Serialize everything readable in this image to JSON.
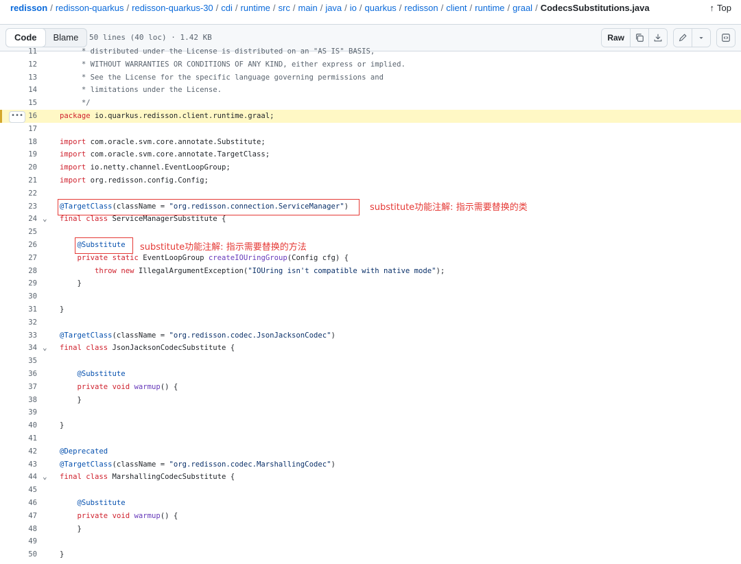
{
  "breadcrumb": {
    "root": "redisson",
    "parts": [
      "redisson-quarkus",
      "redisson-quarkus-30",
      "cdi",
      "runtime",
      "src",
      "main",
      "java",
      "io",
      "quarkus",
      "redisson",
      "client",
      "runtime",
      "graal"
    ],
    "separator": "/",
    "file": "CodecsSubstitutions.java"
  },
  "top_link": "Top",
  "file_header": {
    "tabs": [
      "Code",
      "Blame"
    ],
    "meta": "50 lines (40 loc) · 1.42 KB",
    "raw_label": "Raw"
  },
  "code_lines": [
    {
      "n": "11",
      "t": "     * distributed under the License is distributed on an \"AS IS\" BASIS,"
    },
    {
      "n": "12",
      "t": "     * WITHOUT WARRANTIES OR CONDITIONS OF ANY KIND, either express or implied."
    },
    {
      "n": "13",
      "t": "     * See the License for the specific language governing permissions and"
    },
    {
      "n": "14",
      "t": "     * limitations under the License."
    },
    {
      "n": "15",
      "t": "     */"
    },
    {
      "n": "16",
      "t": "package io.quarkus.redisson.client.runtime.graal;"
    },
    {
      "n": "17",
      "t": ""
    },
    {
      "n": "18",
      "t": "import com.oracle.svm.core.annotate.Substitute;"
    },
    {
      "n": "19",
      "t": "import com.oracle.svm.core.annotate.TargetClass;"
    },
    {
      "n": "20",
      "t": "import io.netty.channel.EventLoopGroup;"
    },
    {
      "n": "21",
      "t": "import org.redisson.config.Config;"
    },
    {
      "n": "22",
      "t": ""
    },
    {
      "n": "23",
      "t": "@TargetClass(className = \"org.redisson.connection.ServiceManager\")"
    },
    {
      "n": "24",
      "t": "final class ServiceManagerSubstitute {"
    },
    {
      "n": "25",
      "t": ""
    },
    {
      "n": "26",
      "t": "    @Substitute"
    },
    {
      "n": "27",
      "t": "    private static EventLoopGroup createIOUringGroup(Config cfg) {"
    },
    {
      "n": "28",
      "t": "        throw new IllegalArgumentException(\"IOUring isn't compatible with native mode\");"
    },
    {
      "n": "29",
      "t": "    }"
    },
    {
      "n": "30",
      "t": ""
    },
    {
      "n": "31",
      "t": "}"
    },
    {
      "n": "32",
      "t": ""
    },
    {
      "n": "33",
      "t": "@TargetClass(className = \"org.redisson.codec.JsonJacksonCodec\")"
    },
    {
      "n": "34",
      "t": "final class JsonJacksonCodecSubstitute {"
    },
    {
      "n": "35",
      "t": ""
    },
    {
      "n": "36",
      "t": "    @Substitute"
    },
    {
      "n": "37",
      "t": "    private void warmup() {"
    },
    {
      "n": "38",
      "t": "    }"
    },
    {
      "n": "39",
      "t": ""
    },
    {
      "n": "40",
      "t": "}"
    },
    {
      "n": "41",
      "t": ""
    },
    {
      "n": "42",
      "t": "@Deprecated"
    },
    {
      "n": "43",
      "t": "@TargetClass(className = \"org.redisson.codec.MarshallingCodec\")"
    },
    {
      "n": "44",
      "t": "final class MarshallingCodecSubstitute {"
    },
    {
      "n": "45",
      "t": ""
    },
    {
      "n": "46",
      "t": "    @Substitute"
    },
    {
      "n": "47",
      "t": "    private void warmup() {"
    },
    {
      "n": "48",
      "t": "    }"
    },
    {
      "n": "49",
      "t": ""
    },
    {
      "n": "50",
      "t": "}"
    }
  ],
  "highlighted_line": "16",
  "fold_lines": [
    "24",
    "34",
    "44"
  ],
  "annotations": {
    "class_note": "substitute功能注解: 指示需要替换的类",
    "method_note": "substitute功能注解: 指示需要替换的方法"
  },
  "colors": {
    "keyword": "#cf222e",
    "annotation": "#0550ae",
    "string": "#0a3069",
    "function": "#6639ba",
    "comment": "#59636e",
    "highlight_bg": "#fff8c5",
    "annotation_box": "#e53935",
    "link": "#0969da"
  }
}
